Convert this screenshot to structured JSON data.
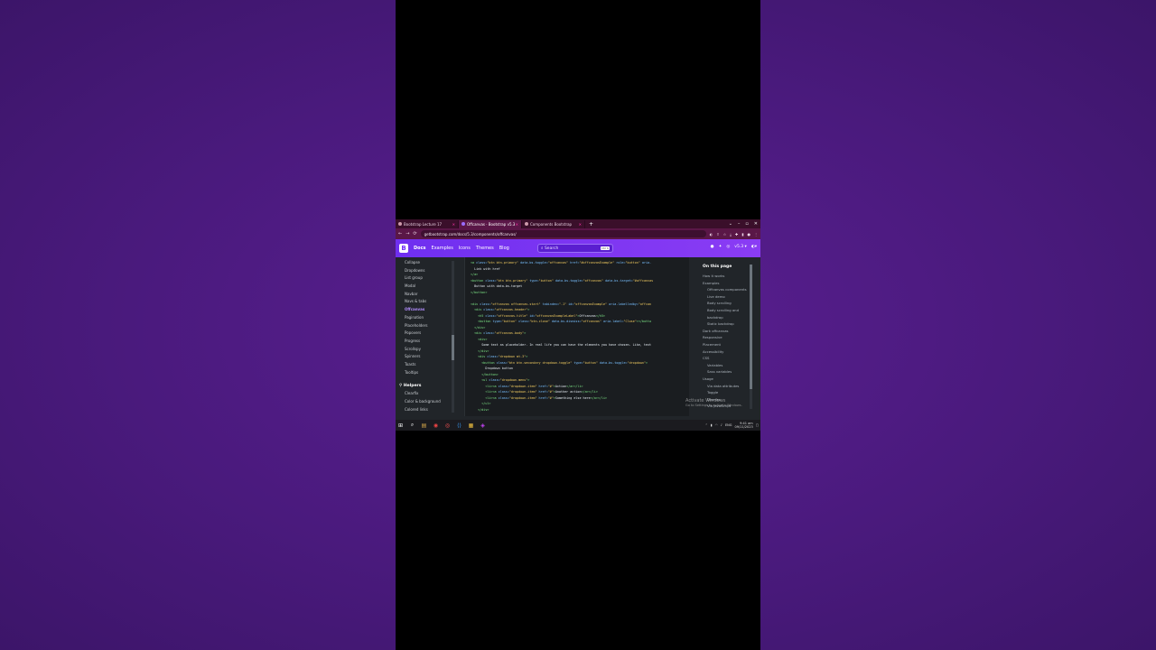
{
  "browser": {
    "tabs": [
      {
        "label": "Bootstrap Lecture 17",
        "active": false
      },
      {
        "label": "Offcanvas · Bootstrap v5.3",
        "active": true
      },
      {
        "label": "Components Bootstrap",
        "active": false
      }
    ],
    "url": "getbootstrap.com/docs/5.3/components/offcanvas/"
  },
  "header": {
    "logo": "B",
    "links": [
      "Docs",
      "Examples",
      "Icons",
      "Themes",
      "Blog"
    ],
    "search_placeholder": "Search",
    "search_kbd": "Ctrl K",
    "version": "v5.3"
  },
  "sidebar": {
    "items": [
      "Collapse",
      "Dropdowns",
      "List group",
      "Modal",
      "Navbar",
      "Navs & tabs",
      "Offcanvas",
      "Pagination",
      "Placeholders",
      "Popovers",
      "Progress",
      "Scrollspy",
      "Spinners",
      "Toasts",
      "Tooltips"
    ],
    "active": "Offcanvas",
    "group": "Helpers",
    "group_items": [
      "Clearfix",
      "Color & background",
      "Colored links"
    ]
  },
  "code_lines": [
    [
      [
        "tag",
        "<a "
      ],
      [
        "attr",
        "class="
      ],
      [
        "val",
        "\"btn btn-primary\""
      ],
      [
        "attr",
        " data-bs-toggle="
      ],
      [
        "val",
        "\"offcanvas\""
      ],
      [
        "attr",
        " href="
      ],
      [
        "val",
        "\"#offcanvasExample\""
      ],
      [
        "attr",
        " role="
      ],
      [
        "val",
        "\"button\""
      ],
      [
        "attr",
        " aria-"
      ]
    ],
    [
      [
        "txt",
        "  Link with href"
      ]
    ],
    [
      [
        "tag",
        "</a>"
      ]
    ],
    [
      [
        "tag",
        "<button "
      ],
      [
        "attr",
        "class="
      ],
      [
        "val",
        "\"btn btn-primary\""
      ],
      [
        "attr",
        " type="
      ],
      [
        "val",
        "\"button\""
      ],
      [
        "attr",
        " data-bs-toggle="
      ],
      [
        "val",
        "\"offcanvas\""
      ],
      [
        "attr",
        " data-bs-target="
      ],
      [
        "val",
        "\"#offcanvas"
      ]
    ],
    [
      [
        "txt",
        "  Button with data-bs-target"
      ]
    ],
    [
      [
        "tag",
        "</button>"
      ]
    ],
    [
      [
        "txt",
        ""
      ]
    ],
    [
      [
        "tag",
        "<div "
      ],
      [
        "attr",
        "class="
      ],
      [
        "val",
        "\"offcanvas offcanvas-start\""
      ],
      [
        "attr",
        " tabindex="
      ],
      [
        "val",
        "\"-1\""
      ],
      [
        "attr",
        " id="
      ],
      [
        "val",
        "\"offcanvasExample\""
      ],
      [
        "attr",
        " aria-labelledby="
      ],
      [
        "val",
        "\"offcan"
      ]
    ],
    [
      [
        "tag",
        "  <div "
      ],
      [
        "attr",
        "class="
      ],
      [
        "val",
        "\"offcanvas-header\""
      ],
      [
        "tag",
        ">"
      ]
    ],
    [
      [
        "tag",
        "    <h5 "
      ],
      [
        "attr",
        "class="
      ],
      [
        "val",
        "\"offcanvas-title\""
      ],
      [
        "attr",
        " id="
      ],
      [
        "val",
        "\"offcanvasExampleLabel\""
      ],
      [
        "tag",
        ">"
      ],
      [
        "txt",
        "Offcanvas"
      ],
      [
        "tag",
        "</h5>"
      ]
    ],
    [
      [
        "tag",
        "    <button "
      ],
      [
        "attr",
        "type="
      ],
      [
        "val",
        "\"button\""
      ],
      [
        "attr",
        " class="
      ],
      [
        "val",
        "\"btn-close\""
      ],
      [
        "attr",
        " data-bs-dismiss="
      ],
      [
        "val",
        "\"offcanvas\""
      ],
      [
        "attr",
        " aria-label="
      ],
      [
        "val",
        "\"Close\""
      ],
      [
        "tag",
        "></butto"
      ]
    ],
    [
      [
        "tag",
        "  </div>"
      ]
    ],
    [
      [
        "tag",
        "  <div "
      ],
      [
        "attr",
        "class="
      ],
      [
        "val",
        "\"offcanvas-body\""
      ],
      [
        "tag",
        ">"
      ]
    ],
    [
      [
        "tag",
        "    <div>"
      ]
    ],
    [
      [
        "txt",
        "      Some text as placeholder. In real life you can have the elements you have chosen. Like, text"
      ]
    ],
    [
      [
        "tag",
        "    </div>"
      ]
    ],
    [
      [
        "tag",
        "    <div "
      ],
      [
        "attr",
        "class="
      ],
      [
        "val",
        "\"dropdown mt-3\""
      ],
      [
        "tag",
        ">"
      ]
    ],
    [
      [
        "tag",
        "      <button "
      ],
      [
        "attr",
        "class="
      ],
      [
        "val",
        "\"btn btn-secondary dropdown-toggle\""
      ],
      [
        "attr",
        " type="
      ],
      [
        "val",
        "\"button\""
      ],
      [
        "attr",
        " data-bs-toggle="
      ],
      [
        "val",
        "\"dropdown\""
      ],
      [
        "tag",
        ">"
      ]
    ],
    [
      [
        "txt",
        "        Dropdown button"
      ]
    ],
    [
      [
        "tag",
        "      </button>"
      ]
    ],
    [
      [
        "tag",
        "      <ul "
      ],
      [
        "attr",
        "class="
      ],
      [
        "val",
        "\"dropdown-menu\""
      ],
      [
        "tag",
        ">"
      ]
    ],
    [
      [
        "tag",
        "        <li><a "
      ],
      [
        "attr",
        "class="
      ],
      [
        "val",
        "\"dropdown-item\""
      ],
      [
        "attr",
        " href="
      ],
      [
        "val",
        "\"#\""
      ],
      [
        "tag",
        ">"
      ],
      [
        "txt",
        "Action"
      ],
      [
        "tag",
        "</a></li>"
      ]
    ],
    [
      [
        "tag",
        "        <li><a "
      ],
      [
        "attr",
        "class="
      ],
      [
        "val",
        "\"dropdown-item\""
      ],
      [
        "attr",
        " href="
      ],
      [
        "val",
        "\"#\""
      ],
      [
        "tag",
        ">"
      ],
      [
        "txt",
        "Another action"
      ],
      [
        "tag",
        "</a></li>"
      ]
    ],
    [
      [
        "tag",
        "        <li><a "
      ],
      [
        "attr",
        "class="
      ],
      [
        "val",
        "\"dropdown-item\""
      ],
      [
        "attr",
        " href="
      ],
      [
        "val",
        "\"#\""
      ],
      [
        "tag",
        ">"
      ],
      [
        "txt",
        "Something else here"
      ],
      [
        "tag",
        "</a></li>"
      ]
    ],
    [
      [
        "tag",
        "      </ul>"
      ]
    ],
    [
      [
        "tag",
        "    </div>"
      ]
    ]
  ],
  "toc": {
    "title": "On this page",
    "items": [
      {
        "label": "How it works",
        "level": 1
      },
      {
        "label": "Examples",
        "level": 1
      },
      {
        "label": "Offcanvas components",
        "level": 2
      },
      {
        "label": "Live demo",
        "level": 2
      },
      {
        "label": "Body scrolling",
        "level": 2
      },
      {
        "label": "Body scrolling and",
        "level": 2
      },
      {
        "label": "backdrop",
        "level": 2
      },
      {
        "label": "Static backdrop",
        "level": 2
      },
      {
        "label": "Dark offcanvas",
        "level": 1
      },
      {
        "label": "Responsive",
        "level": 1
      },
      {
        "label": "Placement",
        "level": 1
      },
      {
        "label": "Accessibility",
        "level": 1
      },
      {
        "label": "CSS",
        "level": 1
      },
      {
        "label": "Variables",
        "level": 2
      },
      {
        "label": "Sass variables",
        "level": 2
      },
      {
        "label": "Usage",
        "level": 1
      },
      {
        "label": "Via data attributes",
        "level": 2
      },
      {
        "label": "Toggle",
        "level": 2
      },
      {
        "label": "Dismiss",
        "level": 2
      },
      {
        "label": "Via JavaScript",
        "level": 2
      }
    ]
  },
  "watermark": {
    "title": "Activate Windows",
    "subtitle": "Go to Settings to activate Windows."
  },
  "taskbar": {
    "time": "9:41 am",
    "date": "09/11/2023"
  }
}
